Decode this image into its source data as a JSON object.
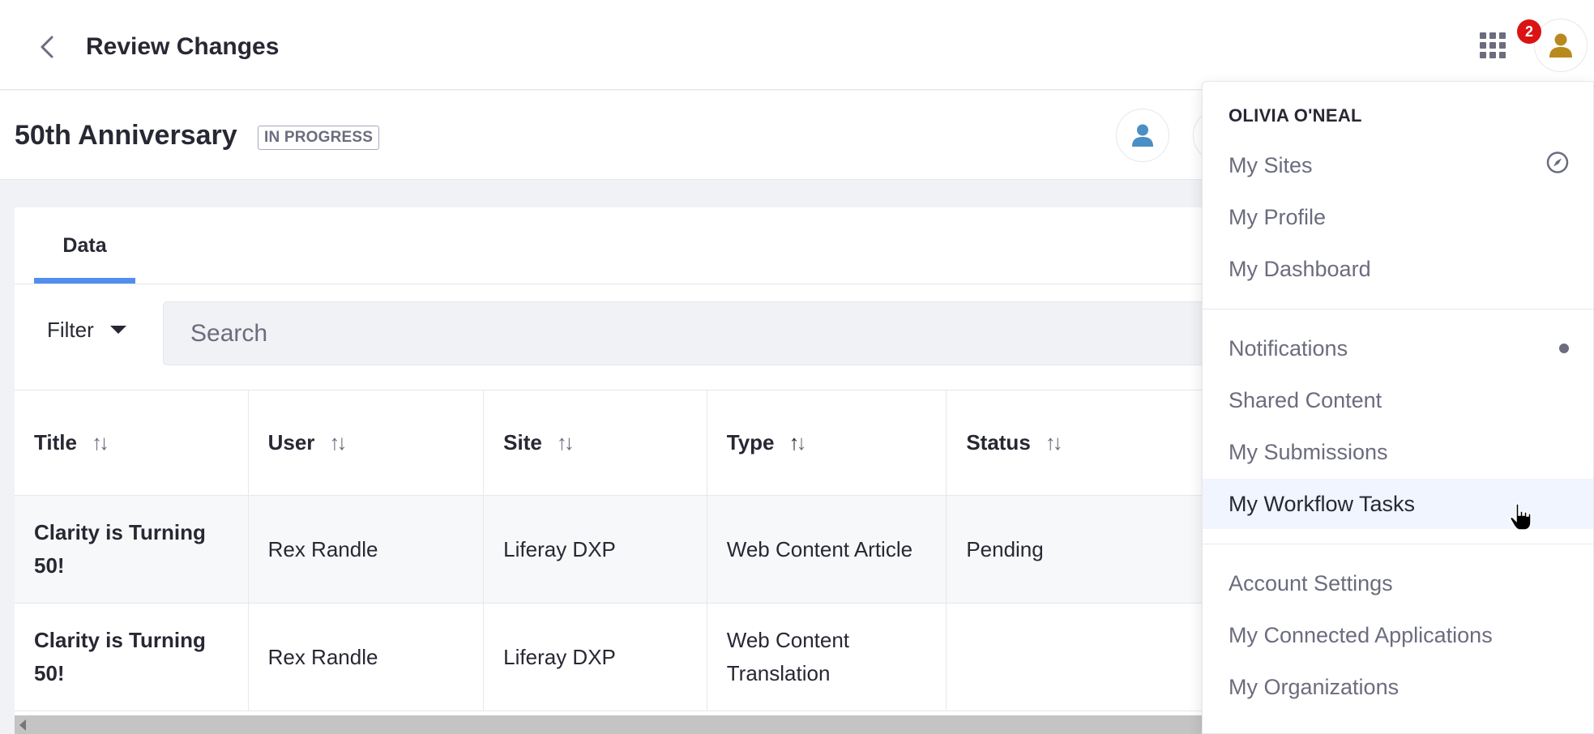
{
  "header": {
    "title": "Review Changes",
    "notification_count": "2"
  },
  "project": {
    "title": "50th Anniversary",
    "status": "IN PROGRESS"
  },
  "tabs": [
    {
      "label": "Data"
    }
  ],
  "toolbar": {
    "filter_label": "Filter",
    "search_placeholder": "Search"
  },
  "table": {
    "columns": [
      "Title",
      "User",
      "Site",
      "Type",
      "Status"
    ],
    "rows": [
      {
        "title": "Clarity is Turning 50!",
        "user": "Rex Randle",
        "site": "Liferay DXP",
        "type": "Web Content Article",
        "status": "Pending"
      },
      {
        "title": "Clarity is Turning 50!",
        "user": "Rex Randle",
        "site": "Liferay DXP",
        "type": "Web Content Translation",
        "status": ""
      }
    ]
  },
  "user_menu": {
    "user_name": "OLIVIA O'NEAL",
    "items": [
      {
        "label": "My Sites"
      },
      {
        "label": "My Profile"
      },
      {
        "label": "My Dashboard"
      },
      {
        "label": "Notifications"
      },
      {
        "label": "Shared Content"
      },
      {
        "label": "My Submissions"
      },
      {
        "label": "My Workflow Tasks"
      },
      {
        "label": "Account Settings"
      },
      {
        "label": "My Connected Applications"
      },
      {
        "label": "My Organizations"
      }
    ]
  },
  "colors": {
    "accent": "#528ef0",
    "badge": "#da1414",
    "avatar_user": "#b88a1e",
    "avatar_reviewer": "#4b8fc4"
  }
}
